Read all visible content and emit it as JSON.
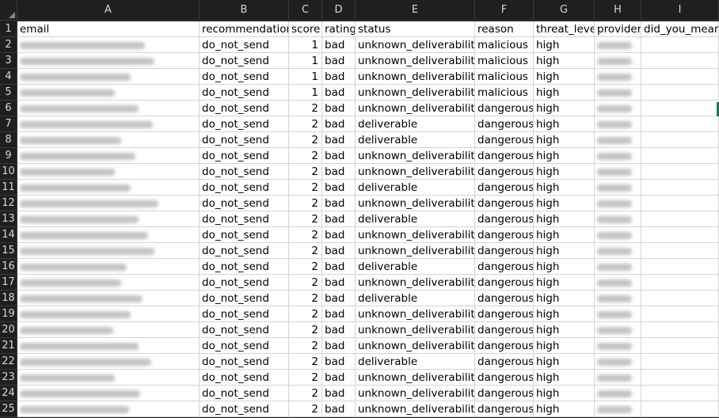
{
  "columns": [
    {
      "letter": "A",
      "field": "email"
    },
    {
      "letter": "B",
      "field": "recommendation"
    },
    {
      "letter": "C",
      "field": "score"
    },
    {
      "letter": "D",
      "field": "rating"
    },
    {
      "letter": "E",
      "field": "status"
    },
    {
      "letter": "F",
      "field": "reason"
    },
    {
      "letter": "G",
      "field": "threat_level"
    },
    {
      "letter": "H",
      "field": "provider"
    },
    {
      "letter": "I",
      "field": "did_you_mean"
    }
  ],
  "header_row": [
    "email",
    "recommendation",
    "score",
    "rating",
    "status",
    "reason",
    "threat_level",
    "provider",
    "did_you_mean"
  ],
  "rows": [
    {
      "n": "2",
      "recommendation": "do_not_send",
      "score": "1",
      "rating": "bad",
      "status": "unknown_deliverability",
      "reason": "malicious",
      "threat_level": "high",
      "did_you_mean": ""
    },
    {
      "n": "3",
      "recommendation": "do_not_send",
      "score": "1",
      "rating": "bad",
      "status": "unknown_deliverability",
      "reason": "malicious",
      "threat_level": "high",
      "did_you_mean": ""
    },
    {
      "n": "4",
      "recommendation": "do_not_send",
      "score": "1",
      "rating": "bad",
      "status": "unknown_deliverability",
      "reason": "malicious",
      "threat_level": "high",
      "did_you_mean": ""
    },
    {
      "n": "5",
      "recommendation": "do_not_send",
      "score": "1",
      "rating": "bad",
      "status": "unknown_deliverability",
      "reason": "malicious",
      "threat_level": "high",
      "did_you_mean": ""
    },
    {
      "n": "6",
      "recommendation": "do_not_send",
      "score": "2",
      "rating": "bad",
      "status": "unknown_deliverability",
      "reason": "dangerous",
      "threat_level": "high",
      "did_you_mean": ""
    },
    {
      "n": "7",
      "recommendation": "do_not_send",
      "score": "2",
      "rating": "bad",
      "status": "deliverable",
      "reason": "dangerous",
      "threat_level": "high",
      "did_you_mean": ""
    },
    {
      "n": "8",
      "recommendation": "do_not_send",
      "score": "2",
      "rating": "bad",
      "status": "deliverable",
      "reason": "dangerous",
      "threat_level": "high",
      "did_you_mean": ""
    },
    {
      "n": "9",
      "recommendation": "do_not_send",
      "score": "2",
      "rating": "bad",
      "status": "unknown_deliverability",
      "reason": "dangerous",
      "threat_level": "high",
      "did_you_mean": ""
    },
    {
      "n": "10",
      "recommendation": "do_not_send",
      "score": "2",
      "rating": "bad",
      "status": "unknown_deliverability",
      "reason": "dangerous",
      "threat_level": "high",
      "did_you_mean": ""
    },
    {
      "n": "11",
      "recommendation": "do_not_send",
      "score": "2",
      "rating": "bad",
      "status": "deliverable",
      "reason": "dangerous",
      "threat_level": "high",
      "did_you_mean": ""
    },
    {
      "n": "12",
      "recommendation": "do_not_send",
      "score": "2",
      "rating": "bad",
      "status": "unknown_deliverability",
      "reason": "dangerous",
      "threat_level": "high",
      "did_you_mean": ""
    },
    {
      "n": "13",
      "recommendation": "do_not_send",
      "score": "2",
      "rating": "bad",
      "status": "deliverable",
      "reason": "dangerous",
      "threat_level": "high",
      "did_you_mean": ""
    },
    {
      "n": "14",
      "recommendation": "do_not_send",
      "score": "2",
      "rating": "bad",
      "status": "unknown_deliverability",
      "reason": "dangerous",
      "threat_level": "high",
      "did_you_mean": ""
    },
    {
      "n": "15",
      "recommendation": "do_not_send",
      "score": "2",
      "rating": "bad",
      "status": "unknown_deliverability",
      "reason": "dangerous",
      "threat_level": "high",
      "did_you_mean": ""
    },
    {
      "n": "16",
      "recommendation": "do_not_send",
      "score": "2",
      "rating": "bad",
      "status": "deliverable",
      "reason": "dangerous",
      "threat_level": "high",
      "did_you_mean": ""
    },
    {
      "n": "17",
      "recommendation": "do_not_send",
      "score": "2",
      "rating": "bad",
      "status": "unknown_deliverability",
      "reason": "dangerous",
      "threat_level": "high",
      "did_you_mean": ""
    },
    {
      "n": "18",
      "recommendation": "do_not_send",
      "score": "2",
      "rating": "bad",
      "status": "deliverable",
      "reason": "dangerous",
      "threat_level": "high",
      "did_you_mean": ""
    },
    {
      "n": "19",
      "recommendation": "do_not_send",
      "score": "2",
      "rating": "bad",
      "status": "unknown_deliverability",
      "reason": "dangerous",
      "threat_level": "high",
      "did_you_mean": ""
    },
    {
      "n": "20",
      "recommendation": "do_not_send",
      "score": "2",
      "rating": "bad",
      "status": "unknown_deliverability",
      "reason": "dangerous",
      "threat_level": "high",
      "did_you_mean": ""
    },
    {
      "n": "21",
      "recommendation": "do_not_send",
      "score": "2",
      "rating": "bad",
      "status": "unknown_deliverability",
      "reason": "dangerous",
      "threat_level": "high",
      "did_you_mean": ""
    },
    {
      "n": "22",
      "recommendation": "do_not_send",
      "score": "2",
      "rating": "bad",
      "status": "deliverable",
      "reason": "dangerous",
      "threat_level": "high",
      "did_you_mean": ""
    },
    {
      "n": "23",
      "recommendation": "do_not_send",
      "score": "2",
      "rating": "bad",
      "status": "unknown_deliverability",
      "reason": "dangerous",
      "threat_level": "high",
      "did_you_mean": ""
    },
    {
      "n": "24",
      "recommendation": "do_not_send",
      "score": "2",
      "rating": "bad",
      "status": "unknown_deliverability",
      "reason": "dangerous",
      "threat_level": "high",
      "did_you_mean": ""
    },
    {
      "n": "25",
      "recommendation": "do_not_send",
      "score": "2",
      "rating": "bad",
      "status": "unknown_deliverability",
      "reason": "dangerous",
      "threat_level": "high",
      "did_you_mean": ""
    }
  ]
}
